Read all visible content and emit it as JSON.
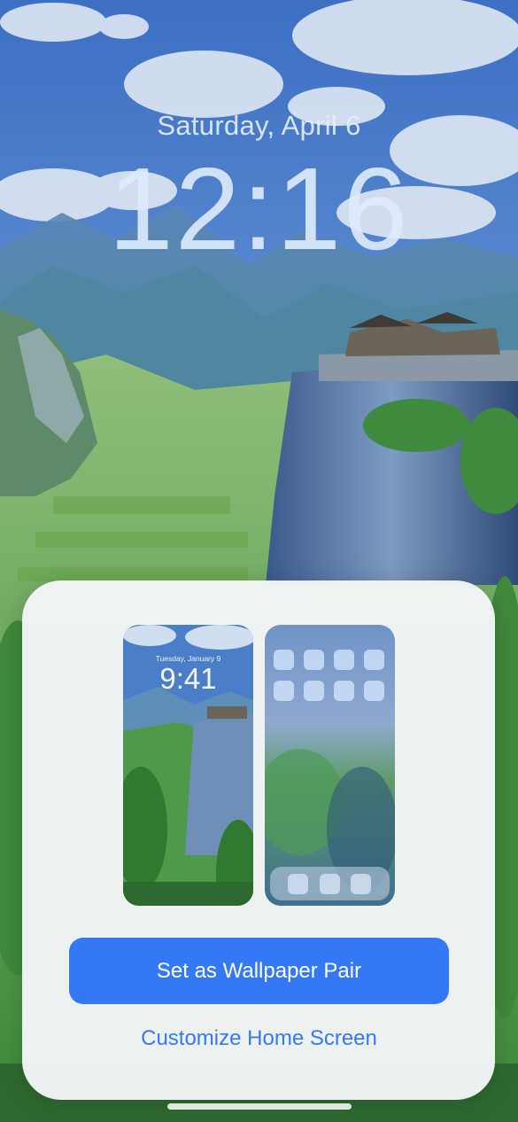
{
  "lock_screen": {
    "date": "Saturday, April 6",
    "time": "12:16"
  },
  "wallpaper_sheet": {
    "lock_preview": {
      "date": "Tuesday, January 9",
      "time": "9:41"
    },
    "home_preview": {
      "app_icon_count": 8,
      "dock_icon_count": 3
    },
    "primary_button_label": "Set as Wallpaper Pair",
    "secondary_button_label": "Customize Home Screen"
  },
  "colors": {
    "accent": "#3478f6",
    "sheet_background": "#f3f5f7",
    "sky": "#4a78c0",
    "foliage": "#3f8a3c"
  }
}
